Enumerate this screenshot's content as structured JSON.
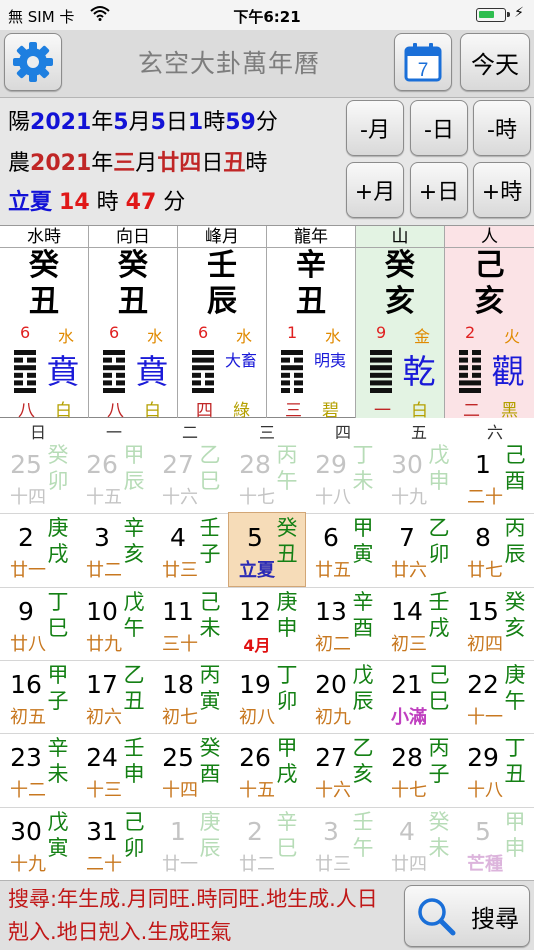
{
  "status_bar": {
    "carrier": "無 SIM 卡",
    "time": "下午6:21"
  },
  "toolbar": {
    "title": "玄空大卦萬年曆",
    "calendar_icon_day": "7",
    "today_label": "今天"
  },
  "info": {
    "solar": {
      "prefix": "陽",
      "year": "2021",
      "year_unit": "年",
      "month": "5",
      "month_unit": "月",
      "day": "5",
      "day_unit": "日",
      "hour": "1",
      "hour_unit": "時",
      "minute": "59",
      "minute_unit": "分"
    },
    "lunar": {
      "prefix": "農",
      "year": "2021",
      "year_unit": "年",
      "month": "三",
      "month_unit": "月",
      "day": "廿四",
      "day_unit": "日",
      "hour": "丑",
      "hour_unit": "時"
    },
    "term": {
      "name": "立夏",
      "hours": "14",
      "hour_unit": "時",
      "minutes": "47",
      "minute_unit": "分"
    }
  },
  "adjust_buttons": {
    "minus_month": "-月",
    "minus_day": "-日",
    "minus_hour": "-時",
    "plus_month": "+月",
    "plus_day": "+日",
    "plus_hour": "+時"
  },
  "pillars": [
    {
      "header": "水時",
      "stem": "癸",
      "branch": "丑",
      "num_left": "6",
      "num_right": "水",
      "trigram": [
        1,
        0,
        1,
        0,
        0,
        1
      ],
      "gua": "賁",
      "bottom_left": "八",
      "bottom_right": "白"
    },
    {
      "header": "向日",
      "stem": "癸",
      "branch": "丑",
      "num_left": "6",
      "num_right": "水",
      "trigram": [
        1,
        0,
        1,
        0,
        0,
        1
      ],
      "gua": "賁",
      "bottom_left": "八",
      "bottom_right": "白"
    },
    {
      "header": "峰月",
      "stem": "壬",
      "branch": "辰",
      "num_left": "6",
      "num_right": "水",
      "trigram": [
        1,
        1,
        1,
        0,
        0,
        1
      ],
      "gua": "大畜",
      "bottom_left": "四",
      "bottom_right": "綠"
    },
    {
      "header": "龍年",
      "stem": "辛",
      "branch": "丑",
      "num_left": "1",
      "num_right": "水",
      "trigram": [
        1,
        0,
        1,
        0,
        0,
        0
      ],
      "gua": "明夷",
      "bottom_left": "三",
      "bottom_right": "碧"
    },
    {
      "header": "山",
      "stem": "癸",
      "branch": "亥",
      "num_left": "9",
      "num_right": "金",
      "trigram": [
        1,
        1,
        1,
        1,
        1,
        1
      ],
      "gua": "乾",
      "bottom_left": "一",
      "bottom_right": "白"
    },
    {
      "header": "人",
      "stem": "己",
      "branch": "亥",
      "num_left": "2",
      "num_right": "火",
      "trigram": [
        0,
        0,
        0,
        0,
        1,
        1
      ],
      "gua": "觀",
      "bottom_left": "二",
      "bottom_right": "黑"
    }
  ],
  "colors": {
    "mountain_bg": "#e3f3e3",
    "person_bg": "#fbe3e6",
    "blue": "#1212d6",
    "red": "#c02626",
    "selected_bg": "#f6dcb8"
  },
  "weekdays": [
    "日",
    "一",
    "二",
    "三",
    "四",
    "五",
    "六"
  ],
  "calendar": [
    [
      {
        "day": "25",
        "gz": "癸卯",
        "lunar": "十四",
        "dim": true
      },
      {
        "day": "26",
        "gz": "甲辰",
        "lunar": "十五",
        "dim": true
      },
      {
        "day": "27",
        "gz": "乙巳",
        "lunar": "十六",
        "dim": true
      },
      {
        "day": "28",
        "gz": "丙午",
        "lunar": "十七",
        "dim": true
      },
      {
        "day": "29",
        "gz": "丁未",
        "lunar": "十八",
        "dim": true
      },
      {
        "day": "30",
        "gz": "戊申",
        "lunar": "十九",
        "dim": true
      },
      {
        "day": "1",
        "gz": "己酉",
        "lunar": "二十"
      }
    ],
    [
      {
        "day": "2",
        "gz": "庚戌",
        "lunar": "廿一"
      },
      {
        "day": "3",
        "gz": "辛亥",
        "lunar": "廿二"
      },
      {
        "day": "4",
        "gz": "壬子",
        "lunar": "廿三"
      },
      {
        "day": "5",
        "gz": "癸丑",
        "lunar": "立夏",
        "selected": true,
        "term": true
      },
      {
        "day": "6",
        "gz": "甲寅",
        "lunar": "廿五"
      },
      {
        "day": "7",
        "gz": "乙卯",
        "lunar": "廿六"
      },
      {
        "day": "8",
        "gz": "丙辰",
        "lunar": "廿七"
      }
    ],
    [
      {
        "day": "9",
        "gz": "丁巳",
        "lunar": "廿八"
      },
      {
        "day": "10",
        "gz": "戊午",
        "lunar": "廿九"
      },
      {
        "day": "11",
        "gz": "己未",
        "lunar": "三十"
      },
      {
        "day": "12",
        "gz": "庚申",
        "lunar": "4月",
        "month": true
      },
      {
        "day": "13",
        "gz": "辛酉",
        "lunar": "初二"
      },
      {
        "day": "14",
        "gz": "壬戌",
        "lunar": "初三"
      },
      {
        "day": "15",
        "gz": "癸亥",
        "lunar": "初四"
      }
    ],
    [
      {
        "day": "16",
        "gz": "甲子",
        "lunar": "初五"
      },
      {
        "day": "17",
        "gz": "乙丑",
        "lunar": "初六"
      },
      {
        "day": "18",
        "gz": "丙寅",
        "lunar": "初七"
      },
      {
        "day": "19",
        "gz": "丁卯",
        "lunar": "初八"
      },
      {
        "day": "20",
        "gz": "戊辰",
        "lunar": "初九"
      },
      {
        "day": "21",
        "gz": "己巳",
        "lunar": "小滿",
        "xm": true
      },
      {
        "day": "22",
        "gz": "庚午",
        "lunar": "十一"
      }
    ],
    [
      {
        "day": "23",
        "gz": "辛未",
        "lunar": "十二"
      },
      {
        "day": "24",
        "gz": "壬申",
        "lunar": "十三"
      },
      {
        "day": "25",
        "gz": "癸酉",
        "lunar": "十四"
      },
      {
        "day": "26",
        "gz": "甲戌",
        "lunar": "十五"
      },
      {
        "day": "27",
        "gz": "乙亥",
        "lunar": "十六"
      },
      {
        "day": "28",
        "gz": "丙子",
        "lunar": "十七"
      },
      {
        "day": "29",
        "gz": "丁丑",
        "lunar": "十八"
      }
    ],
    [
      {
        "day": "30",
        "gz": "戊寅",
        "lunar": "十九"
      },
      {
        "day": "31",
        "gz": "己卯",
        "lunar": "二十"
      },
      {
        "day": "1",
        "gz": "庚辰",
        "lunar": "廿一",
        "dim": true
      },
      {
        "day": "2",
        "gz": "辛巳",
        "lunar": "廿二",
        "dim": true
      },
      {
        "day": "3",
        "gz": "壬午",
        "lunar": "廿三",
        "dim": true
      },
      {
        "day": "4",
        "gz": "癸未",
        "lunar": "廿四",
        "dim": true
      },
      {
        "day": "5",
        "gz": "甲申",
        "lunar": "芒種",
        "dim": true,
        "xm": true
      }
    ]
  ],
  "footer": {
    "search_text": "搜尋:年生成.月同旺.時同旺.地生成.人日剋入.地日剋入.生成旺氣",
    "search_button": "搜尋"
  }
}
